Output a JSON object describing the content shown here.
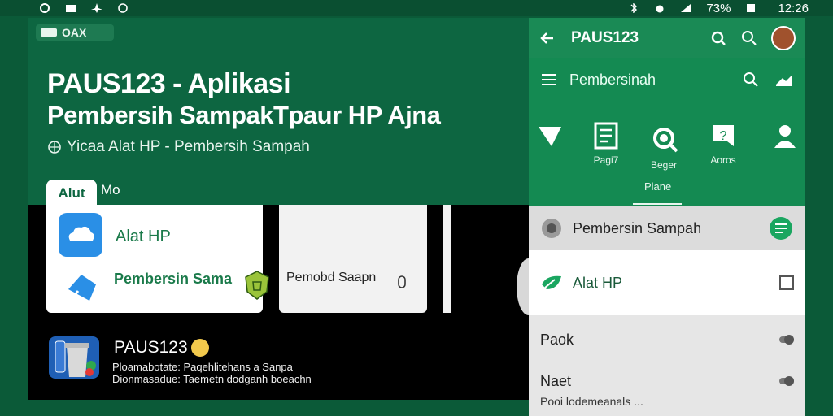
{
  "statusbar": {
    "battery": "73%",
    "time": "12:26"
  },
  "chip": {
    "label": "OAX"
  },
  "hero": {
    "title_line1": "PAUS123 - Aplikasi",
    "title_line2": "Pembersih SampakTpaur HP Ajna",
    "subtitle": "Yicaa Alat HP - Pembersih Sampah"
  },
  "tabs": [
    {
      "label": "Alut"
    },
    {
      "label": "Mo"
    }
  ],
  "cards": {
    "card1_title": "Alat HP",
    "card1_sub": "Pembersin Sama",
    "card2_text": "Pemobd Saapn"
  },
  "bottom_app": {
    "title": "PAUS123",
    "desc1": "Ploamabotate: Paqehlitehans a Sanpa",
    "desc2": "Dionmasadue: Taemetn dodganh boeachn"
  },
  "right": {
    "header_title": "PAUS123",
    "search_label": "Pembersinah",
    "icon_labels": [
      "Pagi7",
      "Beger",
      "Aoros"
    ],
    "icon_sub_label": "Plane",
    "row1": "Pembersin Sampah",
    "row2": "Alat HP",
    "row3": "Paok",
    "row4": "Naet",
    "row4_desc": "Pooi lodemeanals ..."
  },
  "colors": {
    "brand_green": "#0d6641",
    "accent_green": "#1a8a55"
  }
}
